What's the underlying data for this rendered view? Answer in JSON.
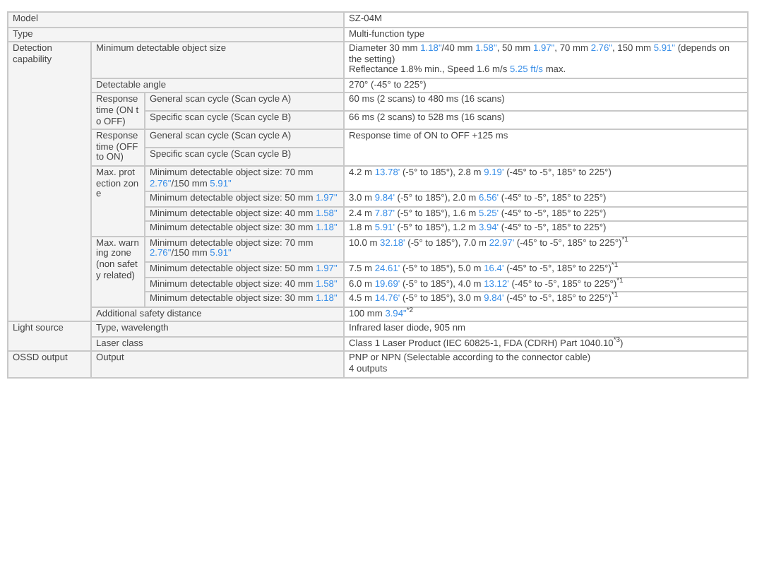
{
  "spec_table": [
    {
      "label": "Model",
      "value": [
        [
          {
            "text": "SZ-04M",
            "kind": "plain"
          }
        ]
      ]
    },
    {
      "label": "Type",
      "value": [
        [
          {
            "text": "Multi-function type",
            "kind": "plain"
          }
        ]
      ]
    },
    {
      "label": "Detection capability",
      "items": [
        {
          "label": "Minimum detectable object size",
          "value": [
            [
              {
                "text": "Diameter 30 mm ",
                "kind": "plain"
              },
              {
                "text": "1.18\"",
                "kind": "imperial"
              },
              {
                "text": "/40 mm ",
                "kind": "plain"
              },
              {
                "text": "1.58\"",
                "kind": "imperial"
              },
              {
                "text": ", 50 mm ",
                "kind": "plain"
              },
              {
                "text": "1.97\"",
                "kind": "imperial"
              },
              {
                "text": ", 70 mm ",
                "kind": "plain"
              },
              {
                "text": "2.76\"",
                "kind": "imperial"
              },
              {
                "text": ", 150 mm ",
                "kind": "plain"
              },
              {
                "text": "5.91\"",
                "kind": "imperial"
              },
              {
                "text": " (depends on the setting)",
                "kind": "plain"
              }
            ],
            [
              {
                "text": "Reflectance 1.8% min., Speed 1.6 m/s ",
                "kind": "plain"
              },
              {
                "text": "5.25 ft/s",
                "kind": "imperial"
              },
              {
                "text": " max.",
                "kind": "plain"
              }
            ]
          ]
        },
        {
          "label": "Detectable angle",
          "value": [
            [
              {
                "text": "270° (-45° to 225°)",
                "kind": "plain"
              }
            ]
          ]
        },
        {
          "label": "Response time (ON to OFF)",
          "items": [
            {
              "label": "General scan cycle (Scan cycle A)",
              "value": [
                [
                  {
                    "text": "60 ms (2 scans) to 480 ms (16 scans)",
                    "kind": "plain"
                  }
                ]
              ]
            },
            {
              "label": "Specific scan cycle (Scan cycle B)",
              "value": [
                [
                  {
                    "text": "66 ms (2 scans) to 528 ms (16 scans)",
                    "kind": "plain"
                  }
                ]
              ]
            }
          ]
        },
        {
          "label": "Response time (OFF to ON)",
          "value": [
            [
              {
                "text": "Response time of ON to OFF +125 ms",
                "kind": "plain"
              }
            ]
          ],
          "items": [
            {
              "label": "General scan cycle (Scan cycle A)"
            },
            {
              "label": "Specific scan cycle (Scan cycle B)"
            }
          ]
        },
        {
          "label": "Max. protection zone",
          "items": [
            {
              "label": [
                {
                  "text": "Minimum detectable object size: 70 mm ",
                  "kind": "plain"
                },
                {
                  "text": "2.76\"",
                  "kind": "imperial"
                },
                {
                  "text": "/150 mm ",
                  "kind": "plain"
                },
                {
                  "text": "5.91\"",
                  "kind": "imperial"
                }
              ],
              "value": [
                [
                  {
                    "text": "4.2 m ",
                    "kind": "plain"
                  },
                  {
                    "text": "13.78'",
                    "kind": "imperial"
                  },
                  {
                    "text": " (-5° to 185°), 2.8 m ",
                    "kind": "plain"
                  },
                  {
                    "text": "9.19'",
                    "kind": "imperial"
                  },
                  {
                    "text": " (-45° to -5°, 185° to 225°)",
                    "kind": "plain"
                  }
                ]
              ]
            },
            {
              "label": [
                {
                  "text": "Minimum detectable object size: 50 mm ",
                  "kind": "plain"
                },
                {
                  "text": "1.97\"",
                  "kind": "imperial"
                }
              ],
              "value": [
                [
                  {
                    "text": "3.0 m ",
                    "kind": "plain"
                  },
                  {
                    "text": "9.84'",
                    "kind": "imperial"
                  },
                  {
                    "text": " (-5° to 185°), 2.0 m ",
                    "kind": "plain"
                  },
                  {
                    "text": "6.56'",
                    "kind": "imperial"
                  },
                  {
                    "text": " (-45° to -5°, 185° to 225°)",
                    "kind": "plain"
                  }
                ]
              ]
            },
            {
              "label": [
                {
                  "text": "Minimum detectable object size: 40 mm ",
                  "kind": "plain"
                },
                {
                  "text": "1.58\"",
                  "kind": "imperial"
                }
              ],
              "value": [
                [
                  {
                    "text": "2.4 m ",
                    "kind": "plain"
                  },
                  {
                    "text": "7.87'",
                    "kind": "imperial"
                  },
                  {
                    "text": " (-5° to 185°), 1.6 m ",
                    "kind": "plain"
                  },
                  {
                    "text": "5.25'",
                    "kind": "imperial"
                  },
                  {
                    "text": " (-45° to -5°, 185° to 225°)",
                    "kind": "plain"
                  }
                ]
              ]
            },
            {
              "label": [
                {
                  "text": "Minimum detectable object size: 30 mm ",
                  "kind": "plain"
                },
                {
                  "text": "1.18\"",
                  "kind": "imperial"
                }
              ],
              "value": [
                [
                  {
                    "text": "1.8 m ",
                    "kind": "plain"
                  },
                  {
                    "text": "5.91'",
                    "kind": "imperial"
                  },
                  {
                    "text": " (-5° to 185°), 1.2 m ",
                    "kind": "plain"
                  },
                  {
                    "text": "3.94'",
                    "kind": "imperial"
                  },
                  {
                    "text": " (-45° to -5°, 185° to 225°)",
                    "kind": "plain"
                  }
                ]
              ]
            }
          ]
        },
        {
          "label": "Max. warning zone (non safety related)",
          "items": [
            {
              "label": [
                {
                  "text": "Minimum detectable object size: 70 mm ",
                  "kind": "plain"
                },
                {
                  "text": "2.76\"",
                  "kind": "imperial"
                },
                {
                  "text": "/150 mm ",
                  "kind": "plain"
                },
                {
                  "text": "5.91\"",
                  "kind": "imperial"
                }
              ],
              "value": [
                [
                  {
                    "text": "10.0 m ",
                    "kind": "plain"
                  },
                  {
                    "text": "32.18'",
                    "kind": "imperial"
                  },
                  {
                    "text": " (-5° to 185°), 7.0 m ",
                    "kind": "plain"
                  },
                  {
                    "text": "22.97'",
                    "kind": "imperial"
                  },
                  {
                    "text": " (-45° to -5°, 185° to 225°)$^{*1}$",
                    "kind": "plain"
                  }
                ]
              ]
            },
            {
              "label": [
                {
                  "text": "Minimum detectable object size: 50 mm ",
                  "kind": "plain"
                },
                {
                  "text": "1.97\"",
                  "kind": "imperial"
                }
              ],
              "value": [
                [
                  {
                    "text": "7.5 m ",
                    "kind": "plain"
                  },
                  {
                    "text": "24.61'",
                    "kind": "imperial"
                  },
                  {
                    "text": " (-5° to 185°), 5.0 m ",
                    "kind": "plain"
                  },
                  {
                    "text": "16.4'",
                    "kind": "imperial"
                  },
                  {
                    "text": " (-45° to -5°, 185° to 225°)$^{*1}$",
                    "kind": "plain"
                  }
                ]
              ]
            },
            {
              "label": [
                {
                  "text": "Minimum detectable object size: 40 mm ",
                  "kind": "plain"
                },
                {
                  "text": "1.58\"",
                  "kind": "imperial"
                }
              ],
              "value": [
                [
                  {
                    "text": "6.0 m ",
                    "kind": "plain"
                  },
                  {
                    "text": "19.69'",
                    "kind": "imperial"
                  },
                  {
                    "text": " (-5° to 185°), 4.0 m ",
                    "kind": "plain"
                  },
                  {
                    "text": "13.12'",
                    "kind": "imperial"
                  },
                  {
                    "text": " (-45° to -5°, 185° to 225°)$^{*1}$",
                    "kind": "plain"
                  }
                ]
              ]
            },
            {
              "label": [
                {
                  "text": "Minimum detectable object size: 30 mm ",
                  "kind": "plain"
                },
                {
                  "text": "1.18\"",
                  "kind": "imperial"
                }
              ],
              "value": [
                [
                  {
                    "text": "4.5 m ",
                    "kind": "plain"
                  },
                  {
                    "text": "14.76'",
                    "kind": "imperial"
                  },
                  {
                    "text": " (-5° to 185°), 3.0 m ",
                    "kind": "plain"
                  },
                  {
                    "text": "9.84'",
                    "kind": "imperial"
                  },
                  {
                    "text": " (-45° to -5°, 185° to 225°)$^{*1}$",
                    "kind": "plain"
                  }
                ]
              ]
            }
          ]
        },
        {
          "label": "Additional safety distance",
          "value": [
            [
              {
                "text": "100 mm ",
                "kind": "plain"
              },
              {
                "text": "3.94\"",
                "kind": "imperial"
              },
              {
                "text": "$^{*2}$",
                "kind": "plain"
              }
            ]
          ]
        }
      ]
    },
    {
      "label": "Light source",
      "items": [
        {
          "label": "Type, wavelength",
          "value": [
            [
              {
                "text": "Infrared laser diode, 905 nm",
                "kind": "plain"
              }
            ]
          ]
        },
        {
          "label": "Laser class",
          "value": [
            [
              {
                "text": "Class 1 Laser Product (IEC 60825-1, FDA (CDRH) Part 1040.10$^{*3}$)",
                "kind": "plain"
              }
            ]
          ]
        }
      ]
    },
    {
      "label": "OSSD output",
      "items": [
        {
          "label": "Output",
          "value": [
            [
              {
                "text": "PNP or NPN (Selectable according to the connector cable)",
                "kind": "plain"
              }
            ],
            [
              {
                "text": "4 outputs",
                "kind": "plain"
              }
            ]
          ]
        }
      ]
    }
  ]
}
